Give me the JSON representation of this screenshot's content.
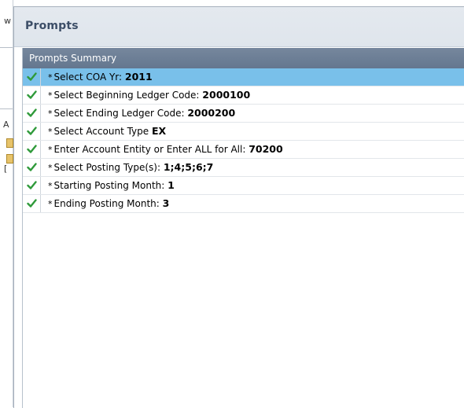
{
  "dialog": {
    "title": "Prompts"
  },
  "summary": {
    "label": "Prompts Summary"
  },
  "prompts": [
    {
      "marker": "*",
      "label": "Select COA Yr: ",
      "value": "2011",
      "selected": true
    },
    {
      "marker": "*",
      "label": "Select Beginning Ledger Code: ",
      "value": "2000100",
      "selected": false
    },
    {
      "marker": "*",
      "label": "Select Ending Ledger Code: ",
      "value": "2000200",
      "selected": false
    },
    {
      "marker": "*",
      "label": "Select Account Type ",
      "value": "EX",
      "selected": false
    },
    {
      "marker": "*",
      "label": "Enter Account Entity or Enter ALL for All: ",
      "value": "70200",
      "selected": false
    },
    {
      "marker": "*",
      "label": "Select Posting Type(s): ",
      "value": "1;4;5;6;7",
      "selected": false
    },
    {
      "marker": "*",
      "label": "Starting Posting Month: ",
      "value": "1",
      "selected": false
    },
    {
      "marker": "*",
      "label": "Ending Posting Month: ",
      "value": "3",
      "selected": false
    }
  ],
  "background": {
    "glyph_top": "w",
    "glyph_mid": "A",
    "glyph_side": "["
  },
  "colors": {
    "check": "#2f9a3a",
    "selected_row": "#79c0ea",
    "summary_bar": "#6b7e95",
    "title": "#3c4e67"
  }
}
